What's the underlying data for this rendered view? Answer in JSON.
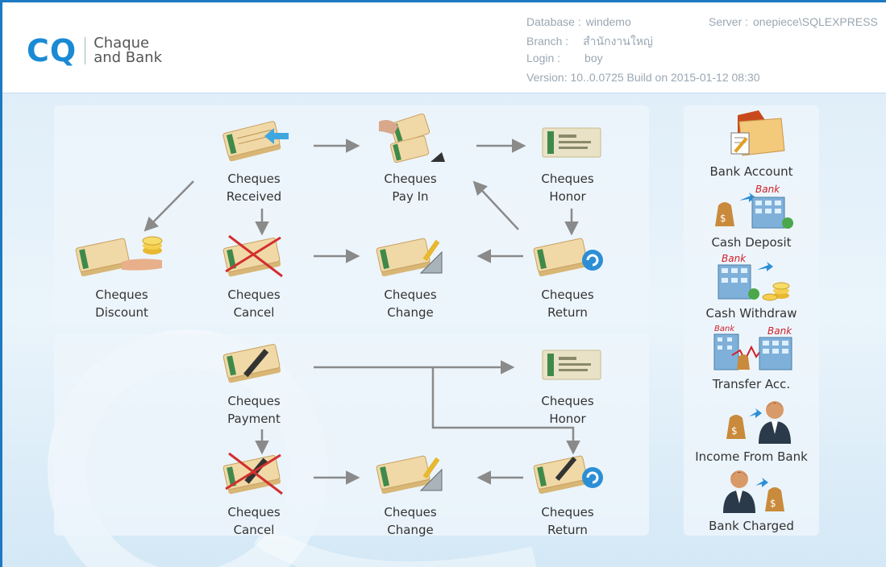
{
  "app": {
    "logo_mark": "CQ",
    "logo_line1": "Chaque",
    "logo_line2": "and Bank"
  },
  "info": {
    "database_label": "Database :",
    "database_value": "windemo",
    "server_label": "Server :",
    "server_value": "onepiece\\SQLEXPRESS",
    "branch_label": "Branch :",
    "branch_value": "สำนักงานใหญ่",
    "login_label": "Login :",
    "login_value": "boy",
    "version_text": "Version: 10..0.0725  Build on 2015-01-12 08:30"
  },
  "receive_flow": {
    "received": {
      "l1": "Cheques",
      "l2": "Received"
    },
    "payin": {
      "l1": "Cheques",
      "l2": "Pay In"
    },
    "honor": {
      "l1": "Cheques",
      "l2": "Honor"
    },
    "discount": {
      "l1": "Cheques",
      "l2": "Discount"
    },
    "cancel": {
      "l1": "Cheques",
      "l2": "Cancel"
    },
    "change": {
      "l1": "Cheques",
      "l2": "Change"
    },
    "return": {
      "l1": "Cheques",
      "l2": "Return"
    }
  },
  "pay_flow": {
    "payment": {
      "l1": "Cheques",
      "l2": "Payment"
    },
    "honor": {
      "l1": "Cheques",
      "l2": "Honor"
    },
    "cancel": {
      "l1": "Cheques",
      "l2": "Cancel"
    },
    "change": {
      "l1": "Cheques",
      "l2": "Change"
    },
    "return": {
      "l1": "Cheques",
      "l2": "Return"
    }
  },
  "bank_menu": {
    "bank_account": "Bank Account",
    "cash_deposit": "Cash Deposit",
    "cash_withdraw": "Cash Withdraw",
    "transfer": "Transfer Acc.",
    "income": "Income From Bank",
    "charged": "Bank Charged",
    "bank_word": "Bank"
  },
  "colors": {
    "accent": "#1a8ad4",
    "arrow": "#8a8a8a",
    "cheque": "#f0d9a6"
  }
}
